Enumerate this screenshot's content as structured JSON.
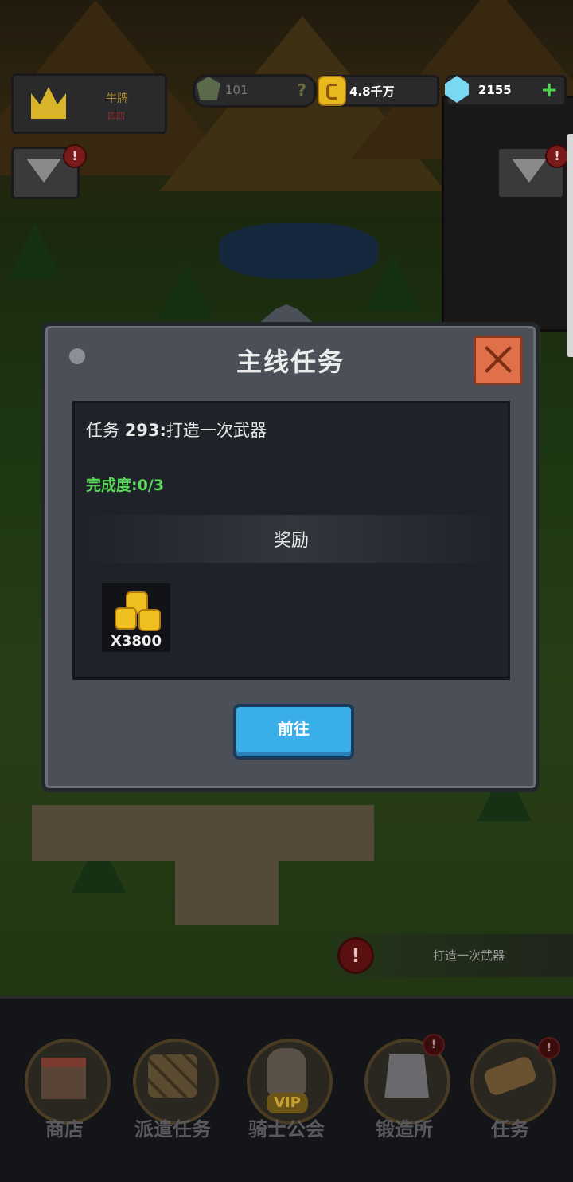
{
  "hud": {
    "player_name": "牛牌",
    "player_subtitle": "四四",
    "power_value": "101",
    "power_hint": "?",
    "gold_value": "4.8千万",
    "gem_value": "2155",
    "gem_add": "+"
  },
  "badges": {
    "alert": "!"
  },
  "quest_dialog": {
    "title": "主线任务",
    "task_prefix": "任务 ",
    "task_number": "293:",
    "task_name": "打造一次武器",
    "progress_label": "完成度:",
    "progress_value": "0/3",
    "reward_header": "奖励",
    "reward_qty": "X3800",
    "go_button": "前往"
  },
  "task_hint": {
    "icon": "!",
    "text": "打造一次武器"
  },
  "nav": {
    "items": [
      {
        "label": "商店",
        "icon": "shop-icon"
      },
      {
        "label": "派遣任务",
        "icon": "wood-logs-icon"
      },
      {
        "label": "骑士公会",
        "icon": "knight-helmet-icon",
        "tag": "VIP"
      },
      {
        "label": "锻造所",
        "icon": "anvil-icon"
      },
      {
        "label": "任务",
        "icon": "scroll-icon"
      }
    ]
  },
  "colors": {
    "accent_blue": "#3aaee8",
    "progress_green": "#58d858",
    "close_orange": "#e0704a"
  }
}
